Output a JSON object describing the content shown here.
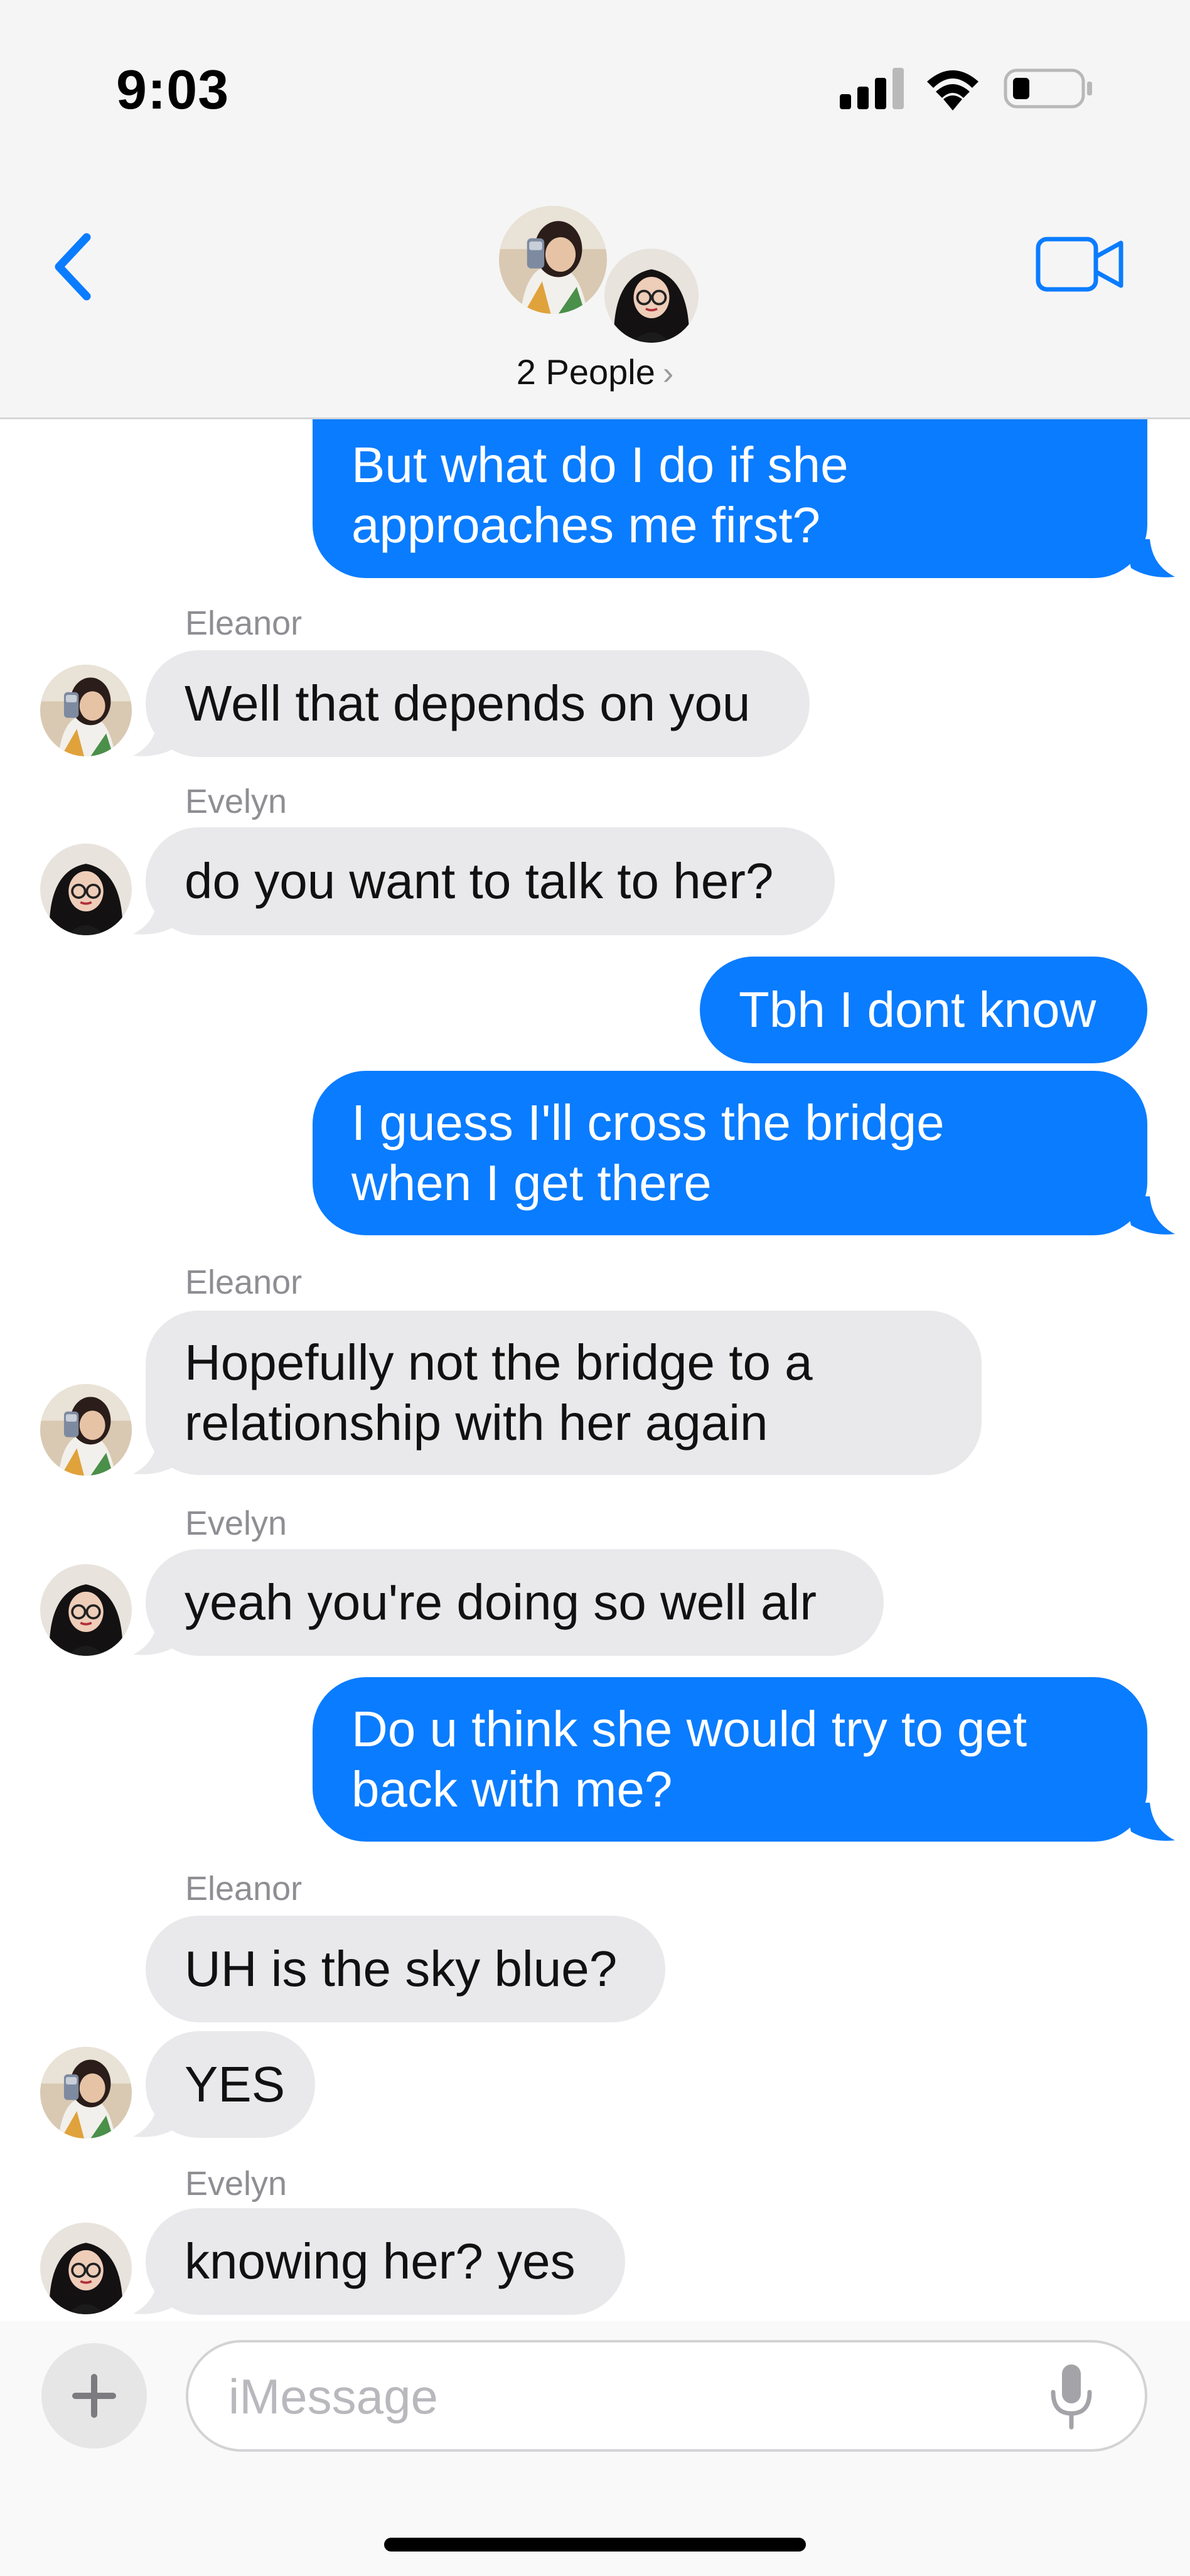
{
  "status_bar": {
    "time": "9:03",
    "signal_icon": "cellular-signal-icon",
    "wifi_icon": "wifi-icon",
    "battery_icon": "battery-low-icon"
  },
  "header": {
    "back_icon": "chevron-left-icon",
    "people_label": "2 People",
    "people_chevron": "›",
    "video_icon": "video-camera-icon"
  },
  "colors": {
    "outgoing": "#0a7cff",
    "incoming": "#e9e9eb",
    "accent": "#0a7cff"
  },
  "messages": [
    {
      "from": "me",
      "text_lines": [
        "But what do I do if she",
        "approaches me first?"
      ]
    },
    {
      "from": "Eleanor",
      "sender": "Eleanor",
      "text_lines": [
        "Well that depends on you"
      ]
    },
    {
      "from": "Evelyn",
      "sender": "Evelyn",
      "text_lines": [
        "do you want to talk to her?"
      ]
    },
    {
      "from": "me",
      "text_lines": [
        "Tbh I dont know"
      ]
    },
    {
      "from": "me",
      "text_lines": [
        "I guess I'll cross the bridge",
        "when I get there"
      ]
    },
    {
      "from": "Eleanor",
      "sender": "Eleanor",
      "text_lines": [
        "Hopefully not the bridge to a",
        "relationship with her again"
      ]
    },
    {
      "from": "Evelyn",
      "sender": "Evelyn",
      "text_lines": [
        "yeah you're doing so well alr"
      ]
    },
    {
      "from": "me",
      "text_lines": [
        "Do u think she would try to get",
        "back with me?"
      ]
    },
    {
      "from": "Eleanor",
      "sender": "Eleanor",
      "text_lines": [
        "UH is the sky blue?"
      ]
    },
    {
      "from": "Eleanor",
      "text_lines": [
        "YES"
      ]
    },
    {
      "from": "Evelyn",
      "sender": "Evelyn",
      "text_lines": [
        "knowing her? yes"
      ]
    }
  ],
  "composer": {
    "placeholder": "iMessage",
    "plus_icon": "plus-icon",
    "mic_icon": "microphone-icon"
  }
}
